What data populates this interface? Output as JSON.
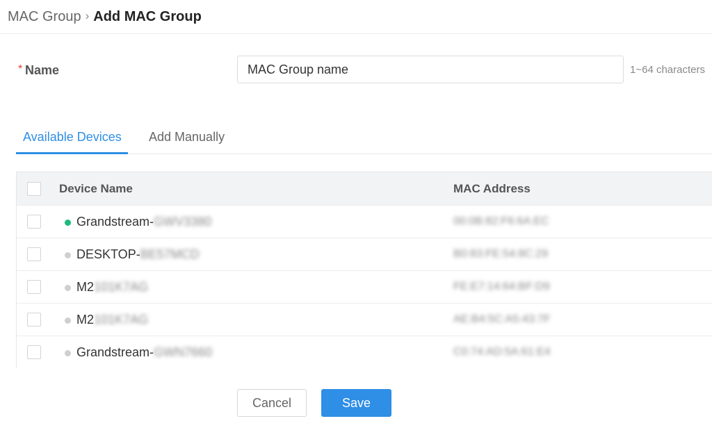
{
  "breadcrumb": {
    "parent": "MAC Group",
    "separator": "›",
    "current": "Add MAC Group"
  },
  "form": {
    "required_mark": "*",
    "name_label": "Name",
    "name_placeholder": "MAC Group name",
    "name_hint": "1~64 characters"
  },
  "tabs": [
    {
      "label": "Available Devices",
      "active": true
    },
    {
      "label": "Add Manually",
      "active": false
    }
  ],
  "table": {
    "columns": [
      "Device Name",
      "MAC Address"
    ],
    "rows": [
      {
        "name_prefix": "Grandstream-",
        "name_suffix": "GWV3380",
        "mac": "00:0B:82:F6:6A:EC",
        "status": "online",
        "status_color": "#1fba7a"
      },
      {
        "name_prefix": "DESKTOP-",
        "name_suffix": "BE57MCD",
        "mac": "B0:83:FE:54:8C:29",
        "status": "offline",
        "status_color": "#cfcfcf"
      },
      {
        "name_prefix": "M2",
        "name_suffix": "101K7AG",
        "mac": "FE:E7:14:64:BF:D9",
        "status": "offline",
        "status_color": "#cfcfcf"
      },
      {
        "name_prefix": "M2",
        "name_suffix": "101K7AG",
        "mac": "AE:B4:5C:A5:43:7F",
        "status": "offline",
        "status_color": "#cfcfcf"
      },
      {
        "name_prefix": "Grandstream-",
        "name_suffix": "GWN7660",
        "mac": "C0:74:AD:5A:61:E4",
        "status": "offline",
        "status_color": "#cfcfcf"
      }
    ]
  },
  "actions": {
    "cancel_label": "Cancel",
    "save_label": "Save"
  },
  "colors": {
    "accent": "#2f8ee6",
    "online": "#1fba7a",
    "offline": "#cfcfcf",
    "required": "#e0412b"
  }
}
